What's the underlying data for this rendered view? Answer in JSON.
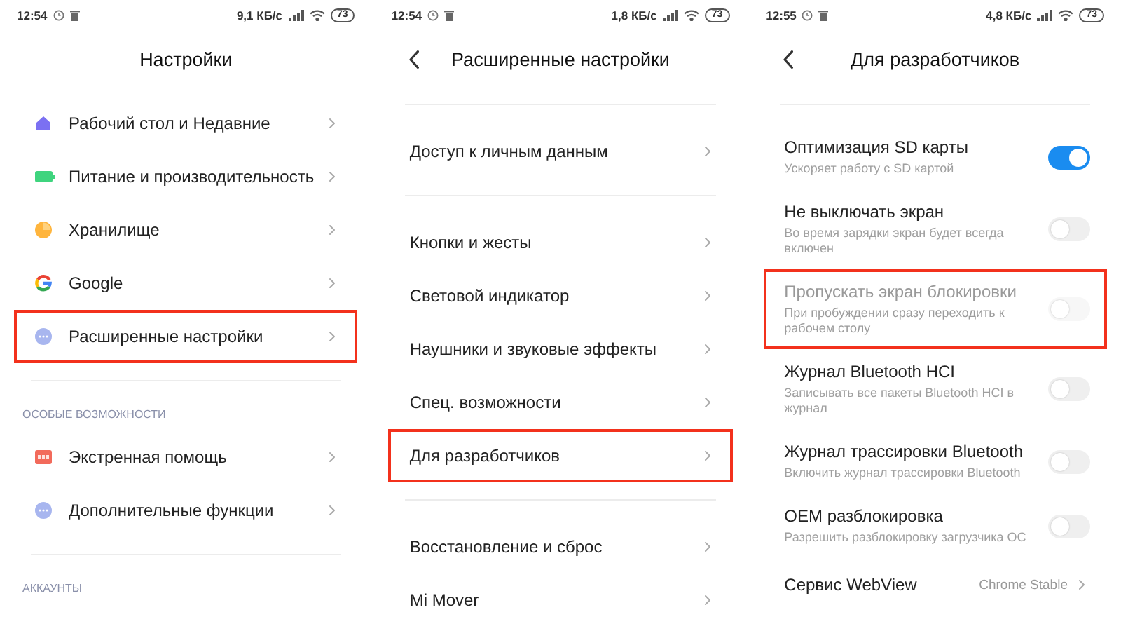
{
  "screens": [
    {
      "status_bar": {
        "time": "12:54",
        "speed": "9,1 КБ/с",
        "battery": "73"
      },
      "header": {
        "title": "Настройки",
        "back": false
      },
      "sections": [
        {
          "items": [
            {
              "kind": "icon_link",
              "label": "Рабочий стол и Недавние",
              "highlighted": false
            },
            {
              "kind": "icon_link",
              "label": "Питание и производительность",
              "highlighted": false
            },
            {
              "kind": "icon_link",
              "label": "Хранилище",
              "highlighted": false
            },
            {
              "kind": "icon_link",
              "label": "Google",
              "highlighted": false
            },
            {
              "kind": "icon_link",
              "label": "Расширенные настройки",
              "highlighted": true
            }
          ]
        },
        {
          "heading": "ОСОБЫЕ ВОЗМОЖНОСТИ",
          "items": [
            {
              "kind": "icon_link",
              "label": "Экстренная помощь",
              "highlighted": false
            },
            {
              "kind": "icon_link",
              "label": "Дополнительные функции",
              "highlighted": false
            }
          ]
        },
        {
          "heading": "АККАУНТЫ"
        }
      ]
    },
    {
      "status_bar": {
        "time": "12:54",
        "speed": "1,8 КБ/с",
        "battery": "73"
      },
      "header": {
        "title": "Расширенные настройки",
        "back": true
      },
      "sections": [
        {
          "items": [
            {
              "kind": "link",
              "label": "Доступ к личным данным",
              "highlighted": false
            }
          ]
        },
        {
          "items": [
            {
              "kind": "link",
              "label": "Кнопки и жесты",
              "highlighted": false
            },
            {
              "kind": "link",
              "label": "Световой индикатор",
              "highlighted": false
            },
            {
              "kind": "link",
              "label": "Наушники и звуковые эффекты",
              "highlighted": false
            },
            {
              "kind": "link",
              "label": "Спец. возможности",
              "highlighted": false
            },
            {
              "kind": "link",
              "label": "Для разработчиков",
              "highlighted": true
            }
          ]
        },
        {
          "items": [
            {
              "kind": "link",
              "label": "Восстановление и сброс",
              "highlighted": false
            },
            {
              "kind": "link",
              "label": "Mi Mover",
              "highlighted": false
            }
          ]
        }
      ]
    },
    {
      "status_bar": {
        "time": "12:55",
        "speed": "4,8 КБ/с",
        "battery": "73"
      },
      "header": {
        "title": "Для разработчиков",
        "back": true
      },
      "sections": [
        {
          "items": [
            {
              "kind": "toggle",
              "label": "Оптимизация SD карты",
              "subtitle": "Ускоряет работу с SD картой",
              "on": true,
              "disabled": false,
              "highlighted": false
            },
            {
              "kind": "toggle",
              "label": "Не выключать экран",
              "subtitle": "Во время зарядки экран будет всегда включен",
              "on": false,
              "disabled": false,
              "highlighted": false
            },
            {
              "kind": "toggle",
              "label": "Пропускать экран блокировки",
              "subtitle": "При пробуждении сразу переходить к рабочем столу",
              "on": false,
              "disabled": true,
              "highlighted": true
            },
            {
              "kind": "toggle",
              "label": "Журнал Bluetooth HCI",
              "subtitle": "Записывать все пакеты Bluetooth HCI в журнал",
              "on": false,
              "disabled": false,
              "highlighted": false
            },
            {
              "kind": "toggle",
              "label": "Журнал трассировки Bluetooth",
              "subtitle": "Включить журнал трассировки Bluetooth",
              "on": false,
              "disabled": false,
              "highlighted": false
            },
            {
              "kind": "toggle",
              "label": "OEM разблокировка",
              "subtitle": "Разрешить разблокировку загрузчика ОС",
              "on": false,
              "disabled": false,
              "highlighted": false
            },
            {
              "kind": "value",
              "label": "Сервис WebView",
              "value": "Chrome Stable",
              "highlighted": false
            }
          ]
        }
      ]
    }
  ]
}
